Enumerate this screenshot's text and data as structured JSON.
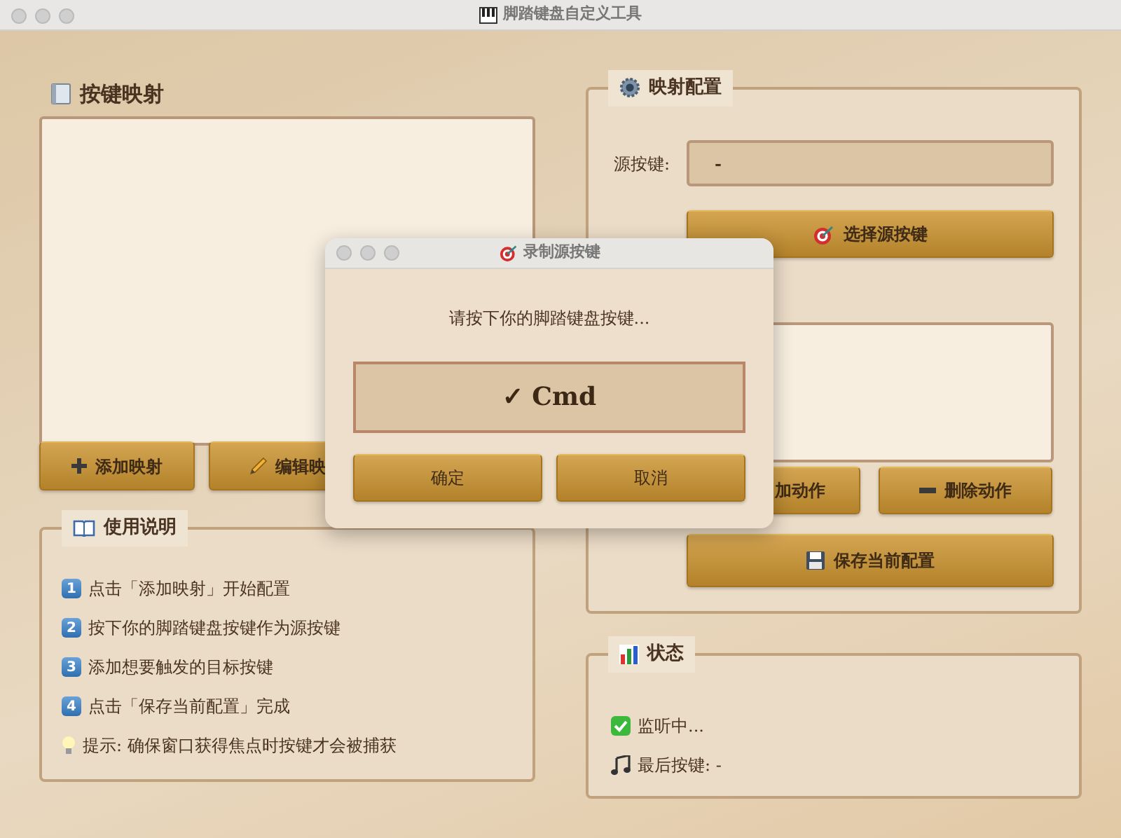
{
  "window": {
    "title": "脚踏键盘自定义工具"
  },
  "mappings_panel": {
    "title": "按键映射",
    "buttons": [
      {
        "kind": "add",
        "label": "添加映射"
      },
      {
        "kind": "edit",
        "label": "编辑映"
      }
    ]
  },
  "help": {
    "title": "使用说明",
    "steps": [
      {
        "kind": "step",
        "number": "1",
        "text": "点击「添加映射」开始配置"
      },
      {
        "kind": "step",
        "number": "2",
        "text": "按下你的脚踏键盘按键作为源按键"
      },
      {
        "kind": "step",
        "number": "3",
        "text": "添加想要触发的目标按键"
      },
      {
        "kind": "step",
        "number": "4",
        "text": "点击「保存当前配置」完成"
      },
      {
        "kind": "tip",
        "text": "提示: 确保窗口获得焦点时按键才会被捕获"
      }
    ]
  },
  "config": {
    "title": "映射配置",
    "source_label": "源按键:",
    "source_value": "-",
    "select_button": "选择源按键",
    "action_buttons": [
      {
        "kind": "add",
        "label": "加动作"
      },
      {
        "kind": "remove",
        "label": "删除动作"
      }
    ],
    "save_button": "保存当前配置"
  },
  "status": {
    "title": "状态",
    "items": [
      {
        "kind": "listening",
        "text": "监听中..."
      },
      {
        "kind": "last_key",
        "text": "最后按键: -"
      }
    ]
  },
  "dialog": {
    "title": "录制源按键",
    "prompt": "请按下你的脚踏键盘按键...",
    "captured": "✓ Cmd",
    "buttons": [
      "确定",
      "取消"
    ]
  }
}
